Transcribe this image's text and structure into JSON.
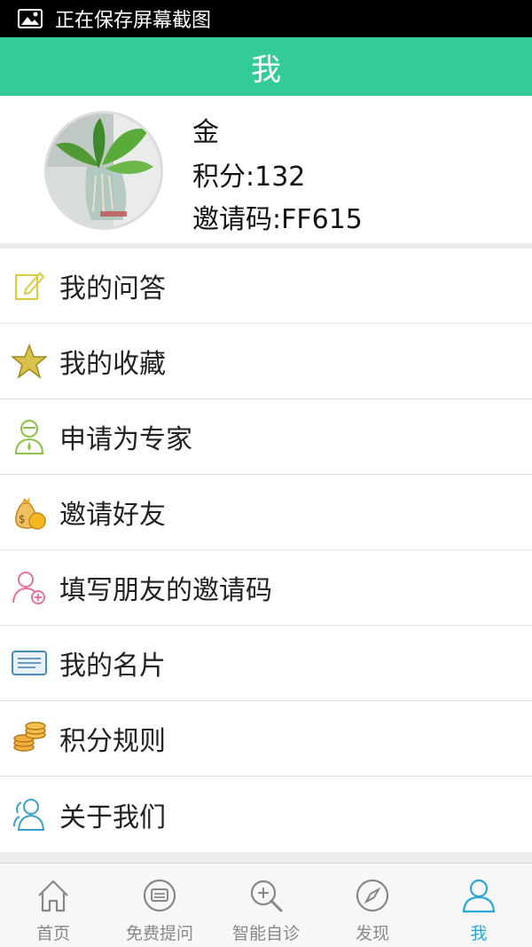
{
  "status_bar": {
    "text": "正在保存屏幕截图",
    "icon": "image-icon"
  },
  "header": {
    "title": "我"
  },
  "profile": {
    "name": "金",
    "score": "积分:132",
    "invite_code": "邀请码:FF615",
    "avatar": "plant-photo-avatar"
  },
  "menu": {
    "items": [
      {
        "label": "我的问答",
        "icon": "edit-icon",
        "color": "#d8cc3c"
      },
      {
        "label": "我的收藏",
        "icon": "star-icon",
        "color": "#c8b43a"
      },
      {
        "label": "申请为专家",
        "icon": "expert-icon",
        "color": "#8cc04a"
      },
      {
        "label": "邀请好友",
        "icon": "money-bag-icon",
        "color": "#f0b428"
      },
      {
        "label": "填写朋友的邀请码",
        "icon": "add-user-icon",
        "color": "#e8709c"
      },
      {
        "label": "我的名片",
        "icon": "card-icon",
        "color": "#4a8ab8"
      },
      {
        "label": "积分规则",
        "icon": "coins-icon",
        "color": "#e8a030"
      },
      {
        "label": "关于我们",
        "icon": "users-icon",
        "color": "#3aa0c8"
      }
    ]
  },
  "tabs": [
    {
      "label": "首页",
      "icon": "home-icon"
    },
    {
      "label": "免费提问",
      "icon": "chat-icon"
    },
    {
      "label": "智能自诊",
      "icon": "search-plus-icon"
    },
    {
      "label": "发现",
      "icon": "compass-icon"
    },
    {
      "label": "我",
      "icon": "person-icon",
      "active": true
    }
  ],
  "colors": {
    "accent": "#33cc99",
    "tab_active": "#2aa9d6",
    "tab_inactive": "#888888"
  }
}
